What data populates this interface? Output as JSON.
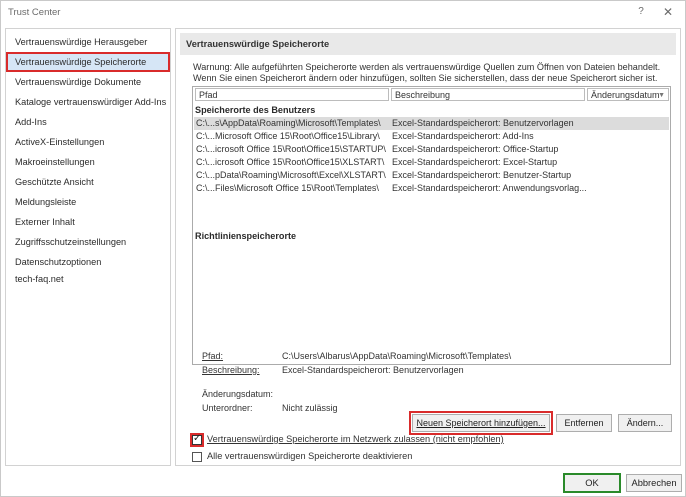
{
  "window": {
    "title": "Trust Center",
    "help_glyph": "?",
    "close_glyph": "✕"
  },
  "sidebar": {
    "items": [
      {
        "label": "Vertrauenswürdige Herausgeber"
      },
      {
        "label": "Vertrauenswürdige Speicherorte",
        "selected": true
      },
      {
        "label": "Vertrauenswürdige Dokumente"
      },
      {
        "label": "Kataloge vertrauenswürdiger Add-Ins"
      },
      {
        "label": "Add-Ins"
      },
      {
        "label": "ActiveX-Einstellungen"
      },
      {
        "label": "Makroeinstellungen"
      },
      {
        "label": "Geschützte Ansicht"
      },
      {
        "label": "Meldungsleiste"
      },
      {
        "label": "Externer Inhalt"
      },
      {
        "label": "Zugriffsschutzeinstellungen"
      },
      {
        "label": "Datenschutzoptionen"
      },
      {
        "label": "tech-faq.net"
      }
    ]
  },
  "main": {
    "section_title": "Vertrauenswürdige Speicherorte",
    "warning": "Warnung: Alle aufgeführten Speicherorte werden als vertrauenswürdige Quellen zum Öffnen von Dateien behandelt. Wenn Sie einen Speicherort ändern oder hinzufügen, sollten Sie sicherstellen, dass der neue Speicherort sicher ist.",
    "columns": {
      "path": "Pfad",
      "description": "Beschreibung",
      "date": "Änderungsdatum",
      "sort_glyph": "▼"
    },
    "user_group_label": "Speicherorte des Benutzers",
    "rows": [
      {
        "path": "C:\\...s\\AppData\\Roaming\\Microsoft\\Templates\\",
        "description": "Excel-Standardspeicherort: Benutzervorlagen",
        "selected": true
      },
      {
        "path": "C:\\...Microsoft Office 15\\Root\\Office15\\Library\\",
        "description": "Excel-Standardspeicherort: Add-Ins"
      },
      {
        "path": "C:\\...icrosoft Office 15\\Root\\Office15\\STARTUP\\",
        "description": "Excel-Standardspeicherort: Office-Startup"
      },
      {
        "path": "C:\\...icrosoft Office 15\\Root\\Office15\\XLSTART\\",
        "description": "Excel-Standardspeicherort: Excel-Startup"
      },
      {
        "path": "C:\\...pData\\Roaming\\Microsoft\\Excel\\XLSTART\\",
        "description": "Excel-Standardspeicherort: Benutzer-Startup"
      },
      {
        "path": "C:\\...Files\\Microsoft Office 15\\Root\\Templates\\",
        "description": "Excel-Standardspeicherort: Anwendungsvorlag..."
      }
    ],
    "policy_group_label": "Richtlinienspeicherorte",
    "details": {
      "path_label": "Pfad:",
      "path_value": "C:\\Users\\Albarus\\AppData\\Roaming\\Microsoft\\Templates\\",
      "description_label": "Beschreibung:",
      "description_value": "Excel-Standardspeicherort: Benutzervorlagen",
      "date_label": "Änderungsdatum:",
      "date_value": "",
      "subfolders_label": "Unterordner:",
      "subfolders_value": "Nicht zulässig"
    },
    "buttons": {
      "add": "Neuen Speicherort hinzufügen...",
      "remove": "Entfernen",
      "change": "Ändern..."
    },
    "checkboxes": {
      "network": {
        "label": "Vertrauenswürdige Speicherorte im Netzwerk zulassen (nicht empfohlen)",
        "checked": true
      },
      "disable_all": {
        "label": "Alle vertrauenswürdigen Speicherorte deaktivieren",
        "checked": false
      }
    }
  },
  "footer": {
    "ok": "OK",
    "cancel": "Abbrechen"
  }
}
